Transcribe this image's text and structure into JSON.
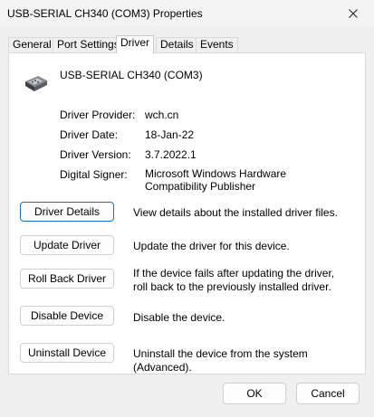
{
  "window": {
    "title": "USB-SERIAL CH340 (COM3) Properties",
    "close_icon": "close-icon"
  },
  "tabs": [
    {
      "label": "General",
      "active": false
    },
    {
      "label": "Port Settings",
      "active": false
    },
    {
      "label": "Driver",
      "active": true
    },
    {
      "label": "Details",
      "active": false
    },
    {
      "label": "Events",
      "active": false
    }
  ],
  "device": {
    "icon": "serial-port-icon",
    "name": "USB-SERIAL CH340 (COM3)"
  },
  "properties": [
    {
      "label": "Driver Provider:",
      "value": "wch.cn"
    },
    {
      "label": "Driver Date:",
      "value": "18-Jan-22"
    },
    {
      "label": "Driver Version:",
      "value": "3.7.2022.1"
    },
    {
      "label": "Digital Signer:",
      "value": "Microsoft Windows Hardware Compatibility Publisher"
    }
  ],
  "actions": [
    {
      "label": "Driver Details",
      "description": "View details about the installed driver files."
    },
    {
      "label": "Update Driver",
      "description": "Update the driver for this device."
    },
    {
      "label": "Roll Back Driver",
      "description": "If the device fails after updating the driver, roll back to the previously installed driver."
    },
    {
      "label": "Disable Device",
      "description": "Disable the device."
    },
    {
      "label": "Uninstall Device",
      "description": "Uninstall the device from the system (Advanced)."
    }
  ],
  "footer": {
    "ok_label": "OK",
    "cancel_label": "Cancel"
  }
}
